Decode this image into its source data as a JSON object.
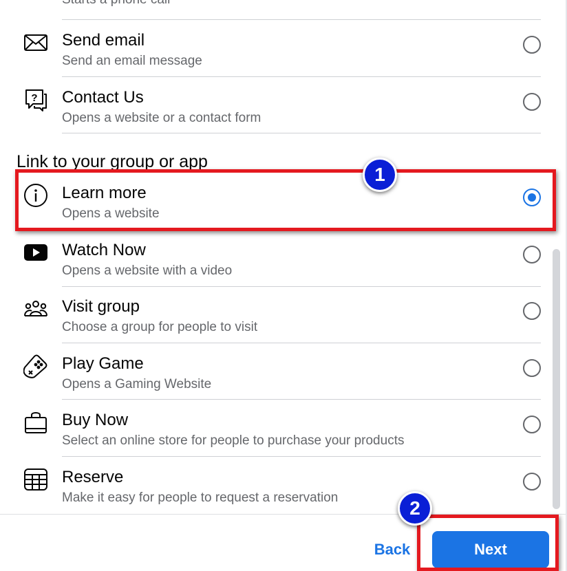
{
  "top_partial_text": "Starts a phone call",
  "options_top": [
    {
      "title": "Send email",
      "subtitle": "Send an email message",
      "icon": "envelope-icon",
      "selected": false
    },
    {
      "title": "Contact Us",
      "subtitle": "Opens a website or a contact form",
      "icon": "question-bubble-icon",
      "selected": false
    }
  ],
  "section_header": "Link to your group or app",
  "options_bottom": [
    {
      "title": "Learn more",
      "subtitle": "Opens a website",
      "icon": "info-icon",
      "selected": true
    },
    {
      "title": "Watch Now",
      "subtitle": "Opens a website with a video",
      "icon": "play-video-icon",
      "selected": false
    },
    {
      "title": "Visit group",
      "subtitle": "Choose a group for people to visit",
      "icon": "group-icon",
      "selected": false
    },
    {
      "title": "Play Game",
      "subtitle": "Opens a Gaming Website",
      "icon": "game-controller-icon",
      "selected": false
    },
    {
      "title": "Buy Now",
      "subtitle": "Select an online store for people to purchase your products",
      "icon": "shopping-bag-icon",
      "selected": false
    },
    {
      "title": "Reserve",
      "subtitle": "Make it easy for people to request a reservation",
      "icon": "calendar-icon",
      "selected": false
    }
  ],
  "footer": {
    "back_label": "Back",
    "next_label": "Next"
  },
  "annotations": {
    "step1": "1",
    "step2": "2"
  },
  "colors": {
    "accent": "#1b74e4",
    "annotation_red": "#e4191f",
    "badge_blue": "#0a1fd6"
  }
}
